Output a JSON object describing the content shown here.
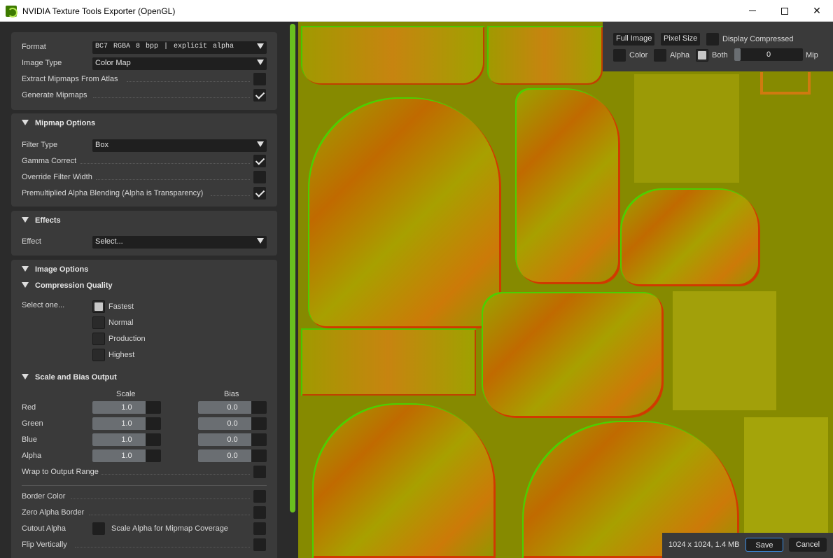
{
  "window": {
    "title": "NVIDIA Texture Tools Exporter (OpenGL)"
  },
  "format_section": {
    "format_label": "Format",
    "format_value": "BC7      RGBA   8 bpp | explicit alpha",
    "image_type_label": "Image Type",
    "image_type_value": "Color Map",
    "extract_mipmaps_label": "Extract Mipmaps From Atlas",
    "extract_mipmaps_checked": false,
    "generate_mipmaps_label": "Generate Mipmaps",
    "generate_mipmaps_checked": true
  },
  "mipmap_options": {
    "header": "Mipmap Options",
    "filter_type_label": "Filter Type",
    "filter_type_value": "Box",
    "gamma_correct_label": "Gamma Correct",
    "gamma_correct_checked": true,
    "override_filter_width_label": "Override Filter Width",
    "override_filter_width_checked": false,
    "premultiplied_label": "Premultiplied Alpha Blending (Alpha is Transparency)",
    "premultiplied_checked": true
  },
  "effects": {
    "header": "Effects",
    "effect_label": "Effect",
    "effect_value": "Select..."
  },
  "image_options": {
    "header": "Image Options",
    "compression_header": "Compression Quality",
    "select_one_label": "Select one...",
    "quality_options": [
      "Fastest",
      "Normal",
      "Production",
      "Highest"
    ],
    "quality_selected": "Fastest",
    "scale_bias_header": "Scale and Bias Output",
    "scale_header": "Scale",
    "bias_header": "Bias",
    "channels": [
      {
        "name": "Red",
        "scale": "1.0",
        "bias": "0.0"
      },
      {
        "name": "Green",
        "scale": "1.0",
        "bias": "0.0"
      },
      {
        "name": "Blue",
        "scale": "1.0",
        "bias": "0.0"
      },
      {
        "name": "Alpha",
        "scale": "1.0",
        "bias": "0.0"
      }
    ],
    "wrap_label": "Wrap to Output Range",
    "border_color_label": "Border Color",
    "zero_alpha_border_label": "Zero Alpha Border",
    "cutout_alpha_label": "Cutout Alpha",
    "scale_alpha_label": "Scale Alpha for Mipmap Coverage",
    "flip_vertically_label": "Flip Vertically"
  },
  "viewer": {
    "full_image_label": "Full Image",
    "pixel_size_label": "Pixel Size",
    "display_compressed_label": "Display Compressed",
    "color_label": "Color",
    "alpha_label": "Alpha",
    "both_label": "Both",
    "both_selected": true,
    "mip_value": "0",
    "mip_label": "Mip",
    "texture_colors": {
      "base": "#868a00",
      "highlight_green": "#4bd000",
      "highlight_red": "#d03a00"
    }
  },
  "footer": {
    "dimensions": "1024 x 1024, 1.4 MB",
    "save_label": "Save",
    "cancel_label": "Cancel"
  }
}
